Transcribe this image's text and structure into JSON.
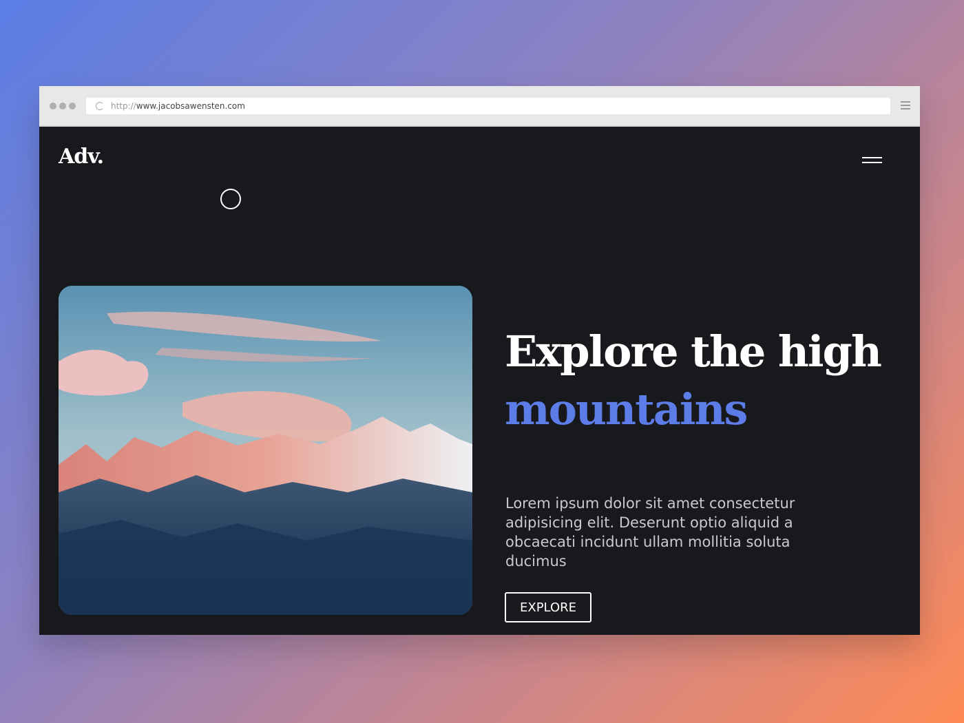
{
  "browser": {
    "url_scheme": "http://",
    "url_host": "www.jacobsawensten.com"
  },
  "site": {
    "logo": "Adv.",
    "headline_line1": "Explore the high",
    "headline_line2": "mountains",
    "description": "Lorem ipsum dolor sit amet consectetur adipisicing elit. Deserunt optio aliquid a obcaecati incidunt ullam mollitia soluta ducimus",
    "cta_label": "EXPLORE"
  },
  "colors": {
    "accent": "#5c7ce8",
    "page_bg": "#18191c"
  },
  "icons": [
    "reload-icon",
    "browser-menu-icon",
    "hamburger-menu-icon"
  ]
}
